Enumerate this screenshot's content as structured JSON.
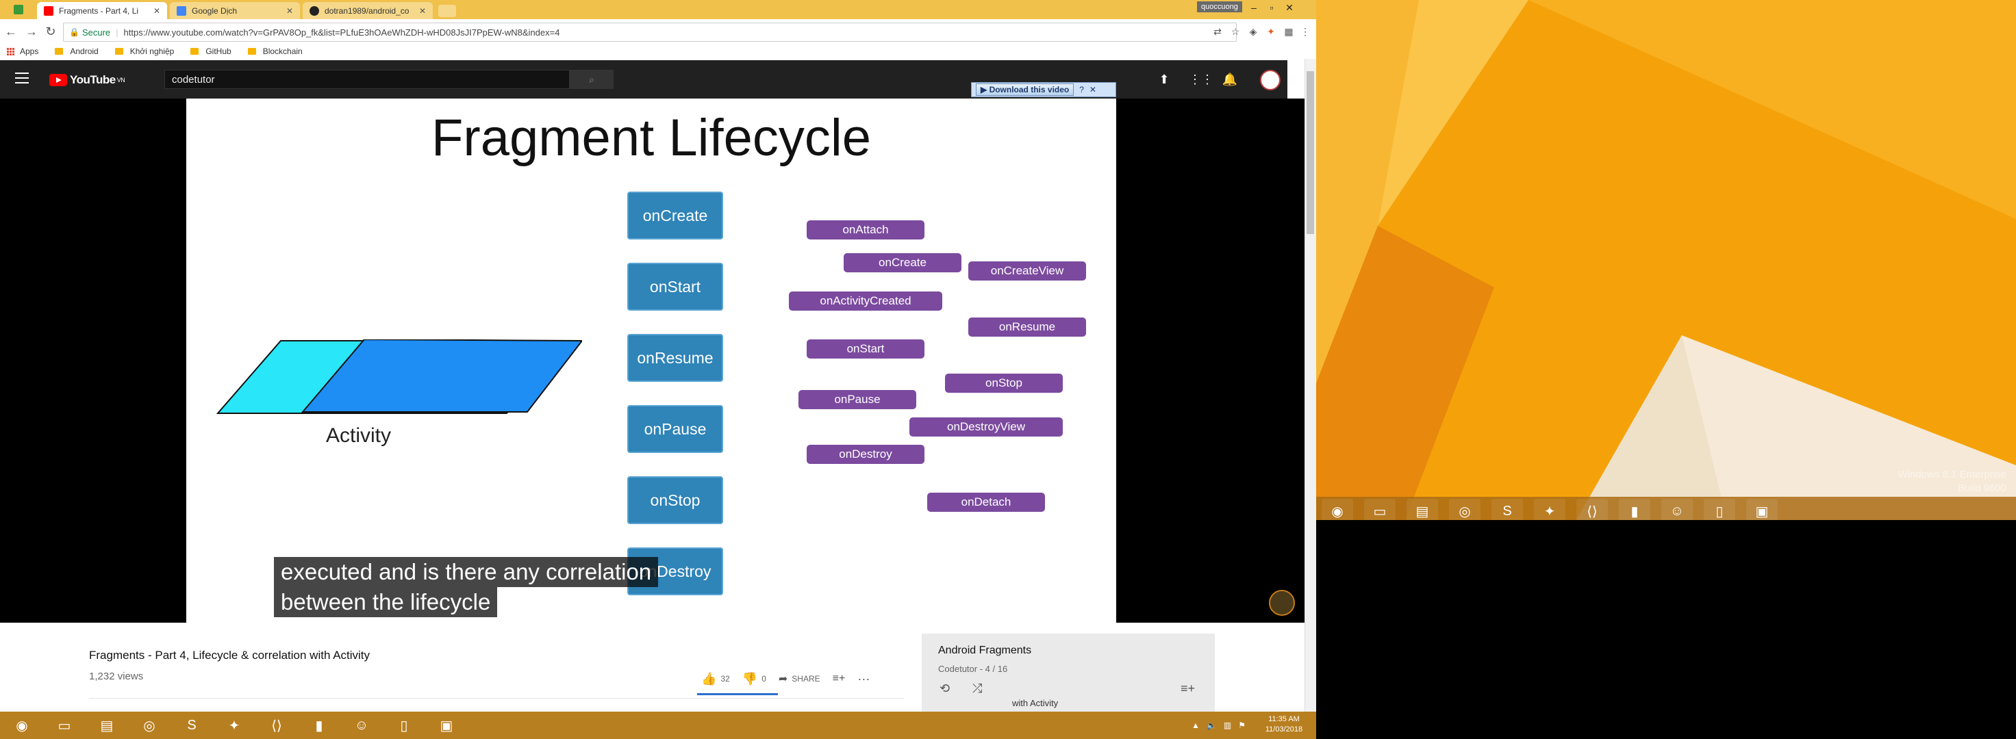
{
  "browser": {
    "tabs": [
      {
        "label": "Fragments - Part 4, Li",
        "favicon_color": "#ff0000"
      },
      {
        "label": "Google Dịch",
        "favicon_color": "#4285f4"
      },
      {
        "label": "dotran1989/android_co",
        "favicon_color": "#222222"
      }
    ],
    "window_user": "quoccuong",
    "secure_label": "Secure",
    "url": "https://www.youtube.com/watch?v=GrPAV8Op_fk&list=PLfuE3hOAeWhZDH-wHD08JsJI7PpEW-wN8&index=4",
    "bookmarks": [
      "Apps",
      "Android",
      "Khởi nghiệp",
      "GitHub",
      "Blockchain"
    ]
  },
  "youtube": {
    "logo_text": "YouTube",
    "region": "VN",
    "search_value": "codetutor",
    "download_video_label": "Download this video"
  },
  "slide": {
    "title": "Fragment Lifecycle",
    "activity_label": "Activity",
    "activity_callbacks": [
      "onCreate",
      "onStart",
      "onResume",
      "onPause",
      "onStop",
      "onDestroy"
    ],
    "fragment_callbacks": [
      "onAttach",
      "onCreate",
      "onCreateView",
      "onActivityCreated",
      "onResume",
      "onStart",
      "onStop",
      "onPause",
      "onDestroyView",
      "onDestroy",
      "onDetach"
    ],
    "colors": {
      "activity_box": "#2f84b8",
      "fragment_pill": "#7b4a9e",
      "activity_shape_back": "#29e6f8",
      "activity_shape_front": "#1e8ef5"
    }
  },
  "subtitles": {
    "line1": "executed and is there any correlation",
    "line2": "between the lifecycle"
  },
  "video": {
    "title": "Fragments - Part 4, Lifecycle & correlation with Activity",
    "views": "1,232 views",
    "likes": "32",
    "dislikes": "0",
    "share_label": "SHARE"
  },
  "playlist": {
    "title": "Android Fragments",
    "subtitle": "Codetutor - 4 / 16",
    "visible_item": "with Activity"
  },
  "desktop": {
    "watermark_line1": "Windows 8.1 Enterprise",
    "watermark_line2": "Build 9600"
  },
  "taskbar": {
    "time": "11:35 AM",
    "date": "11/03/2018"
  }
}
